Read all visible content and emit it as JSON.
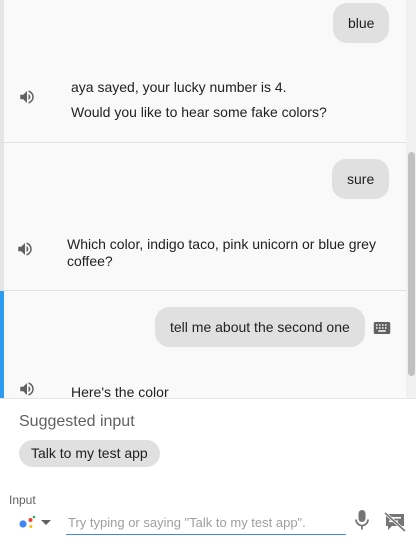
{
  "conversation": {
    "turns": [
      {
        "user": "blue",
        "bot_lines": [
          "aya sayed, your lucky number is 4.",
          "Would you like to hear some fake colors?"
        ]
      },
      {
        "user": "sure",
        "bot_lines": [
          "Which color, indigo taco, pink unicorn or blue grey coffee?"
        ]
      },
      {
        "user": "tell me about the second one",
        "bot_lines": [
          "Here's the color"
        ]
      }
    ]
  },
  "suggestions": {
    "title": "Suggested input",
    "chips": [
      "Talk to my test app"
    ]
  },
  "input": {
    "label": "Input",
    "placeholder": "Try typing or saying \"Talk to my test app\"."
  },
  "icons": {
    "speaker": "volume-up-icon",
    "keyboard": "keyboard-icon",
    "assistant": "google-assistant-icon",
    "mic": "mic-icon",
    "no_display": "speaker-notes-off-icon"
  },
  "colors": {
    "active_turn_accent": "#2d9cf0",
    "input_underline": "#4285f4",
    "bubble": "#e0e0e0"
  }
}
